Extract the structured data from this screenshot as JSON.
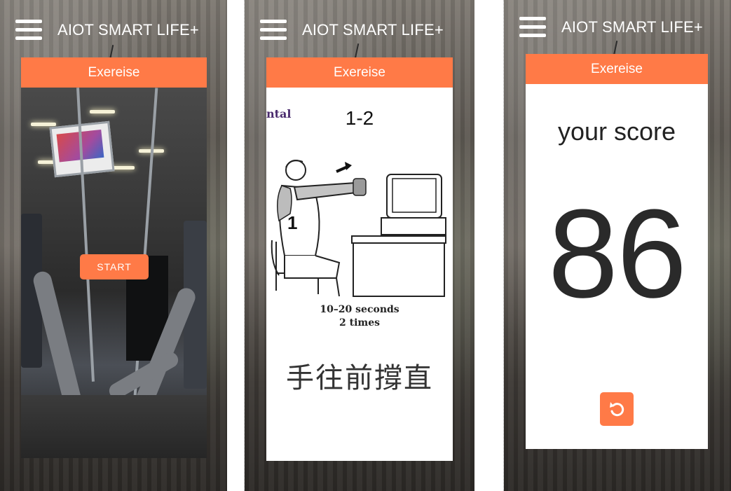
{
  "app_title": "AIOT SMART LIFE+",
  "card_header": "Exereise",
  "screen1": {
    "start_label": "START"
  },
  "screen2": {
    "partial_text": "ntal",
    "step_label": "1-2",
    "figure_number": "1",
    "duration_line1": "10–20 seconds",
    "duration_line2": "2 times",
    "instruction": "手往前撐直"
  },
  "screen3": {
    "score_label": "your score",
    "score_value": "86",
    "retry_icon": "undo-icon"
  },
  "colors": {
    "accent": "#ff7a47",
    "header_text": "#ffffff",
    "score_text": "#2a2a2a"
  }
}
